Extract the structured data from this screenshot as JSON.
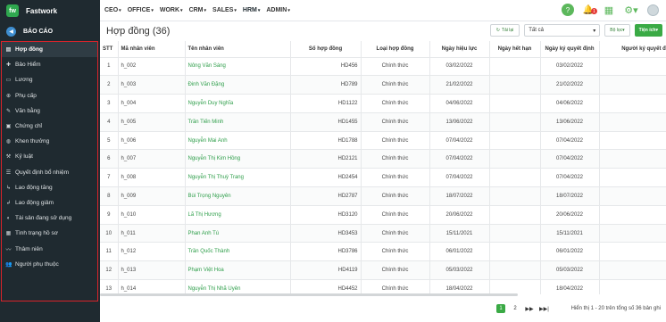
{
  "app": {
    "name": "Fastwork",
    "logo_text": "fw",
    "section_title": "BÁO CÁO"
  },
  "nav": [
    "CEO",
    "OFFICE",
    "WORK",
    "CRM",
    "SALES",
    "HRM",
    "ADMIN"
  ],
  "notification_count": "1",
  "sidebar": {
    "items": [
      {
        "label": "Hợp đồng",
        "icon": "file-icon",
        "glyph": "▤",
        "active": true
      },
      {
        "label": "Bảo Hiểm",
        "icon": "insurance-icon",
        "glyph": "✚"
      },
      {
        "label": "Lương",
        "icon": "salary-icon",
        "glyph": "▭"
      },
      {
        "label": "Phụ cấp",
        "icon": "allowance-icon",
        "glyph": "⊕"
      },
      {
        "label": "Văn bằng",
        "icon": "degree-icon",
        "glyph": "✎"
      },
      {
        "label": "Chứng chỉ",
        "icon": "certificate-icon",
        "glyph": "▣"
      },
      {
        "label": "Khen thưởng",
        "icon": "reward-icon",
        "glyph": "◍"
      },
      {
        "label": "Kỷ luật",
        "icon": "discipline-icon",
        "glyph": "⚒"
      },
      {
        "label": "Quyết định bổ nhiệm",
        "icon": "appointment-icon",
        "glyph": "☰"
      },
      {
        "label": "Lao động tăng",
        "icon": "labor-increase-icon",
        "glyph": "↳"
      },
      {
        "label": "Lao động giảm",
        "icon": "labor-decrease-icon",
        "glyph": "↲"
      },
      {
        "label": "Tài sản đang sử dụng",
        "icon": "asset-icon",
        "glyph": "◐"
      },
      {
        "label": "Tình trạng hồ sơ",
        "icon": "profile-status-icon",
        "glyph": "▦"
      },
      {
        "label": "Thâm niên",
        "icon": "seniority-icon",
        "glyph": "〰"
      },
      {
        "label": "Người phụ thuộc",
        "icon": "dependents-icon",
        "glyph": "👥"
      }
    ]
  },
  "toolbar": {
    "title": "Hợp đồng (36)",
    "reload_label": "Tải lại",
    "select_value": "Tất cả",
    "filter_label": "Bộ lọc",
    "utility_label": "Tiện ích"
  },
  "table": {
    "columns": [
      "STT",
      "Mã nhân viên",
      "Tên nhân viên",
      "Số hợp đồng",
      "Loại hợp đồng",
      "Ngày hiệu lực",
      "Ngày hết hạn",
      "Ngày ký quyết định",
      "Người ký quyết định"
    ],
    "rows": [
      [
        "1",
        "h_002",
        "Nông Văn Sáng",
        "HD456",
        "Chính thức",
        "03/02/2022",
        "",
        "03/02/2022",
        ""
      ],
      [
        "2",
        "h_003",
        "Đinh Văn Đặng",
        "HD789",
        "Chính thức",
        "21/02/2022",
        "",
        "21/02/2022",
        ""
      ],
      [
        "3",
        "h_004",
        "Nguyễn Duy Nghĩa",
        "HD1122",
        "Chính thức",
        "04/06/2022",
        "",
        "04/06/2022",
        ""
      ],
      [
        "4",
        "h_005",
        "Trần Tiến Minh",
        "HD1455",
        "Chính thức",
        "13/06/2022",
        "",
        "13/06/2022",
        ""
      ],
      [
        "5",
        "h_006",
        "Nguyễn Mai Anh",
        "HD1788",
        "Chính thức",
        "07/04/2022",
        "",
        "07/04/2022",
        ""
      ],
      [
        "6",
        "h_007",
        "Nguyễn Thị Kim Hồng",
        "HD2121",
        "Chính thức",
        "07/04/2022",
        "",
        "07/04/2022",
        ""
      ],
      [
        "7",
        "h_008",
        "Nguyễn Thị Thuỳ Trang",
        "HD2454",
        "Chính thức",
        "07/04/2022",
        "",
        "07/04/2022",
        ""
      ],
      [
        "8",
        "h_009",
        "Bùi Trọng Nguyên",
        "HD2787",
        "Chính thức",
        "18/07/2022",
        "",
        "18/07/2022",
        ""
      ],
      [
        "9",
        "h_010",
        "Lã Thị Hương",
        "HD3120",
        "Chính thức",
        "20/06/2022",
        "",
        "20/06/2022",
        ""
      ],
      [
        "10",
        "h_011",
        "Phan Anh Tú",
        "HD3453",
        "Chính thức",
        "15/11/2021",
        "",
        "15/11/2021",
        ""
      ],
      [
        "11",
        "h_012",
        "Trần Quốc Thành",
        "HD3786",
        "Chính thức",
        "06/01/2022",
        "",
        "06/01/2022",
        ""
      ],
      [
        "12",
        "h_013",
        "Phạm Việt Hoa",
        "HD4119",
        "Chính thức",
        "05/03/2022",
        "",
        "05/03/2022",
        ""
      ],
      [
        "13",
        "h_014",
        "Nguyễn Thị Nhã Uyên",
        "HD4452",
        "Chính thức",
        "18/04/2022",
        "",
        "18/04/2022",
        ""
      ]
    ]
  },
  "pagination": {
    "current": "1",
    "next_page": "2",
    "next_icon": "▶▶",
    "last_icon": "▶▶|",
    "range_text": "Hiển thị 1 - 20 trên tổng số 36 bản ghi"
  }
}
